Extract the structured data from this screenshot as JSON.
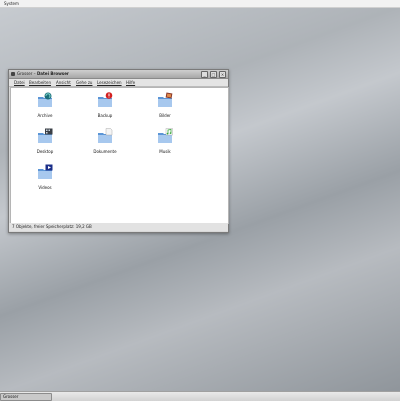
{
  "top_panel": {
    "menu_label": "System"
  },
  "window": {
    "title_prefix": "Grosser",
    "title_app": "Datei Browser",
    "buttons": {
      "minimize": "_",
      "maximize": "□",
      "close": "×"
    }
  },
  "menubar": [
    "Datei",
    "Bearbeiten",
    "Ansicht",
    "Gehe zu",
    "Lesezeichen",
    "Hilfe"
  ],
  "files": [
    {
      "name": "Archive",
      "icon": "archive-folder-icon"
    },
    {
      "name": "Backup",
      "icon": "backup-folder-icon"
    },
    {
      "name": "Bilder",
      "icon": "pictures-folder-icon"
    },
    {
      "name": "Desktop",
      "icon": "desktop-folder-icon"
    },
    {
      "name": "Dokumente",
      "icon": "documents-folder-icon"
    },
    {
      "name": "Musik",
      "icon": "music-folder-icon"
    },
    {
      "name": "Videos",
      "icon": "videos-folder-icon"
    }
  ],
  "statusbar": {
    "text": "7 Objekte, freier Speicherplatz: 19,2 GB"
  },
  "taskbar": {
    "item_label": "Grosser"
  },
  "colors": {
    "folder_blue": "#5b95d6",
    "folder_light": "#a7c8ee",
    "accent_red": "#d32020",
    "accent_green": "#37a53a"
  }
}
